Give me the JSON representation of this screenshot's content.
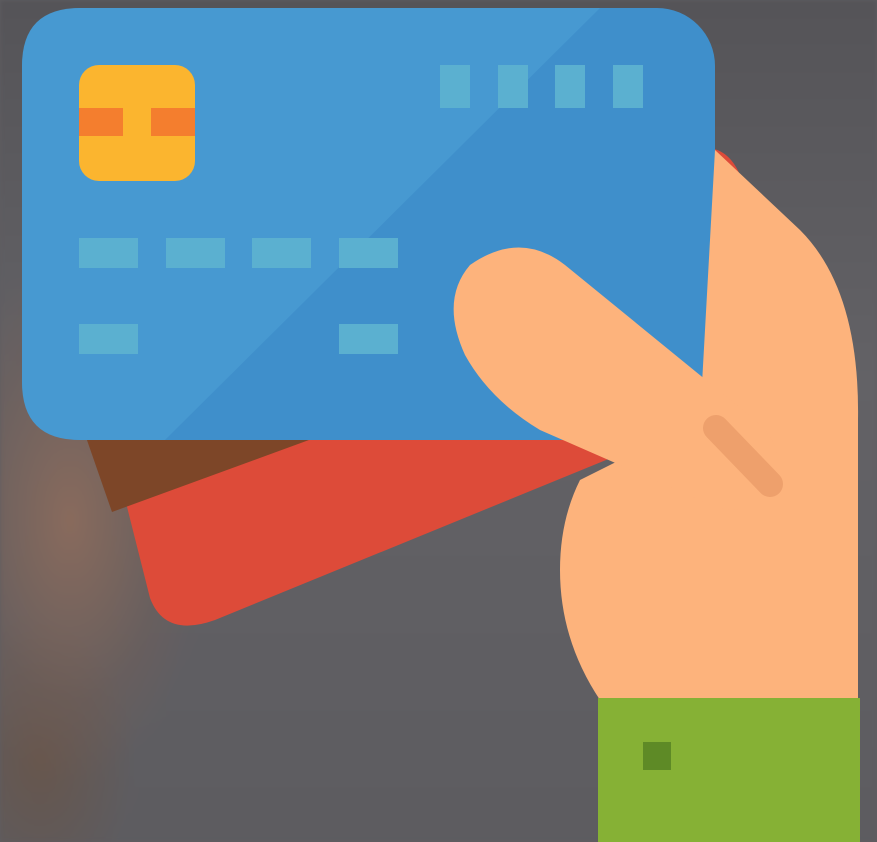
{
  "scene": {
    "subject": "hand-holding-credit-cards",
    "icon": "credit-card-payment-icon"
  },
  "colors": {
    "background": "#5f5e61",
    "front_card": "#3f8fcb",
    "front_card_highlight": "#4597d0",
    "card_lines": "#5bb0d0",
    "chip": "#fbb52f",
    "chip_contacts": "#f47e2e",
    "back_card": "#dd4b39",
    "back_card_stripe": "#7d4628",
    "skin": "#fdb37c",
    "skin_crease": "#eea06c",
    "sleeve": "#86b135",
    "sleeve_button": "#5e8a26"
  }
}
